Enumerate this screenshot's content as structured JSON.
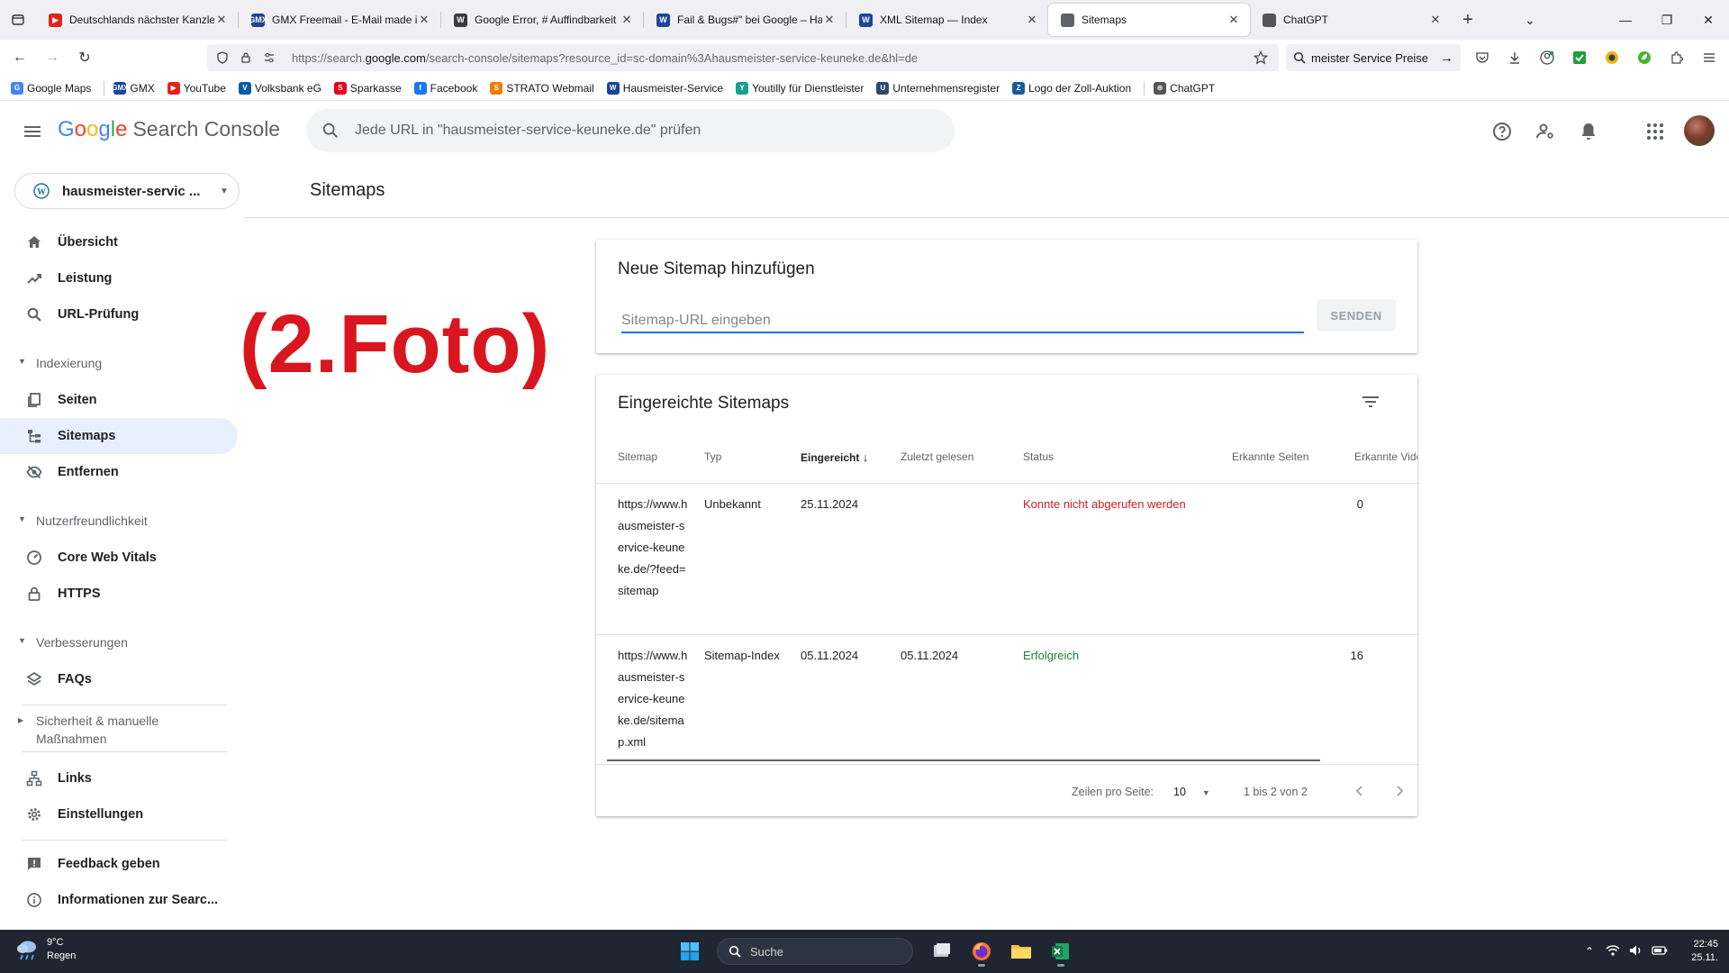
{
  "browser": {
    "tabs": [
      {
        "label": "Deutschlands nächster Kanzler",
        "fav_color": "#e0241b",
        "fav_text": "▶",
        "active": false
      },
      {
        "label": "GMX Freemail - E-Mail made in",
        "fav_color": "#1c449b",
        "fav_text": "GMX",
        "active": false
      },
      {
        "label": "Google Error, # Auffindbarkeit S",
        "fav_color": "#3a3a3a",
        "fav_text": "W",
        "active": false
      },
      {
        "label": "Fail & Bugs#\" bei Google – Hau",
        "fav_color": "#1c449b",
        "fav_text": "W",
        "active": false
      },
      {
        "label": "XML Sitemap — Index",
        "fav_color": "#1c449b",
        "fav_text": "W",
        "active": false
      },
      {
        "label": "Sitemaps",
        "fav_color": "#5f6368",
        "fav_text": "",
        "active": true
      },
      {
        "label": "ChatGPT",
        "fav_color": "#555555",
        "fav_text": "",
        "active": false
      }
    ],
    "url_prefix": "https://search.",
    "url_domain": "google.com",
    "url_rest": "/search-console/sitemaps?resource_id=sc-domain%3Ahausmeister-service-keuneke.de&hl=de",
    "search_value": "meister Service Preise",
    "bookmarks": [
      {
        "label": "Google Maps",
        "fav_color": "#4285f4",
        "fav_text": "G"
      },
      {
        "label": "GMX",
        "fav_color": "#1c449b",
        "fav_text": "GMX"
      },
      {
        "label": "YouTube",
        "fav_color": "#e0241b",
        "fav_text": "▶"
      },
      {
        "label": "Volksbank eG",
        "fav_color": "#0a5aa8",
        "fav_text": "V"
      },
      {
        "label": "Sparkasse",
        "fav_color": "#e3001b",
        "fav_text": "S"
      },
      {
        "label": "Facebook",
        "fav_color": "#1877f2",
        "fav_text": "f"
      },
      {
        "label": "STRATO Webmail",
        "fav_color": "#ef7d00",
        "fav_text": "S"
      },
      {
        "label": "Hausmeister-Service",
        "fav_color": "#1c449b",
        "fav_text": "W"
      },
      {
        "label": "Youtilly für Dienstleister",
        "fav_color": "#1a9e8f",
        "fav_text": "Y"
      },
      {
        "label": "Unternehmensregister",
        "fav_color": "#2c4a6b",
        "fav_text": "U"
      },
      {
        "label": "Logo der Zoll-Auktion",
        "fav_color": "#1a5a9a",
        "fav_text": "Z"
      },
      {
        "label": "ChatGPT",
        "fav_color": "#555555",
        "fav_text": "⊛"
      }
    ]
  },
  "header": {
    "logo_google": "Google",
    "logo_product": "Search Console",
    "inspect_placeholder": "Jede URL in \"hausmeister-service-keuneke.de\" prüfen"
  },
  "sidebar": {
    "property": "hausmeister-servic ...",
    "items": {
      "overview": "Übersicht",
      "performance": "Leistung",
      "url_inspection": "URL-Prüfung",
      "indexing_section": "Indexierung",
      "pages": "Seiten",
      "sitemaps": "Sitemaps",
      "removals": "Entfernen",
      "experience_section": "Nutzerfreundlichkeit",
      "cwv": "Core Web Vitals",
      "https": "HTTPS",
      "enhancements_section": "Verbesserungen",
      "faqs": "FAQs",
      "security_section_line1": "Sicherheit & manuelle",
      "security_section_line2": "Maßnahmen",
      "links": "Links",
      "settings": "Einstellungen",
      "feedback": "Feedback geben",
      "about": "Informationen zur Searc..."
    }
  },
  "main": {
    "page_title": "Sitemaps",
    "overlay": "(2.Foto)",
    "add_card": {
      "title": "Neue Sitemap hinzufügen",
      "input_placeholder": "Sitemap-URL eingeben",
      "submit_label": "SENDEN"
    },
    "list_card": {
      "title": "Eingereichte Sitemaps",
      "columns": {
        "sitemap": "Sitemap",
        "type": "Typ",
        "submitted": "Eingereicht",
        "last_read": "Zuletzt gelesen",
        "status": "Status",
        "pages": "Erkannte Seiten",
        "videos": "Erkannte Vide"
      },
      "rows": [
        {
          "sitemap": "https://www.hausmeister-service-keuneke.de/?feed=sitemap",
          "type": "Unbekannt",
          "submitted": "25.11.2024",
          "last_read": "",
          "status": "Konnte nicht abgerufen werden",
          "status_kind": "fail",
          "pages": "0"
        },
        {
          "sitemap": "https://www.hausmeister-service-keuneke.de/sitemap.xml",
          "type": "Sitemap-Index",
          "submitted": "05.11.2024",
          "last_read": "05.11.2024",
          "status": "Erfolgreich",
          "status_kind": "ok",
          "pages": "16"
        }
      ],
      "pager": {
        "rows_per_page_label": "Zeilen pro Seite:",
        "rows_per_page_value": "10",
        "range": "1 bis 2 von 2"
      }
    }
  },
  "taskbar": {
    "temperature": "9°C",
    "weather": "Regen",
    "search_label": "Suche",
    "time": "22:45",
    "date": "25.11."
  },
  "colors": {
    "google_blue": "#4285f4",
    "google_red": "#ea4335",
    "google_yellow": "#fbbc05",
    "google_green": "#34a853",
    "active_nav": "#e8f0fe",
    "error": "#c5221f",
    "success": "#188038"
  }
}
